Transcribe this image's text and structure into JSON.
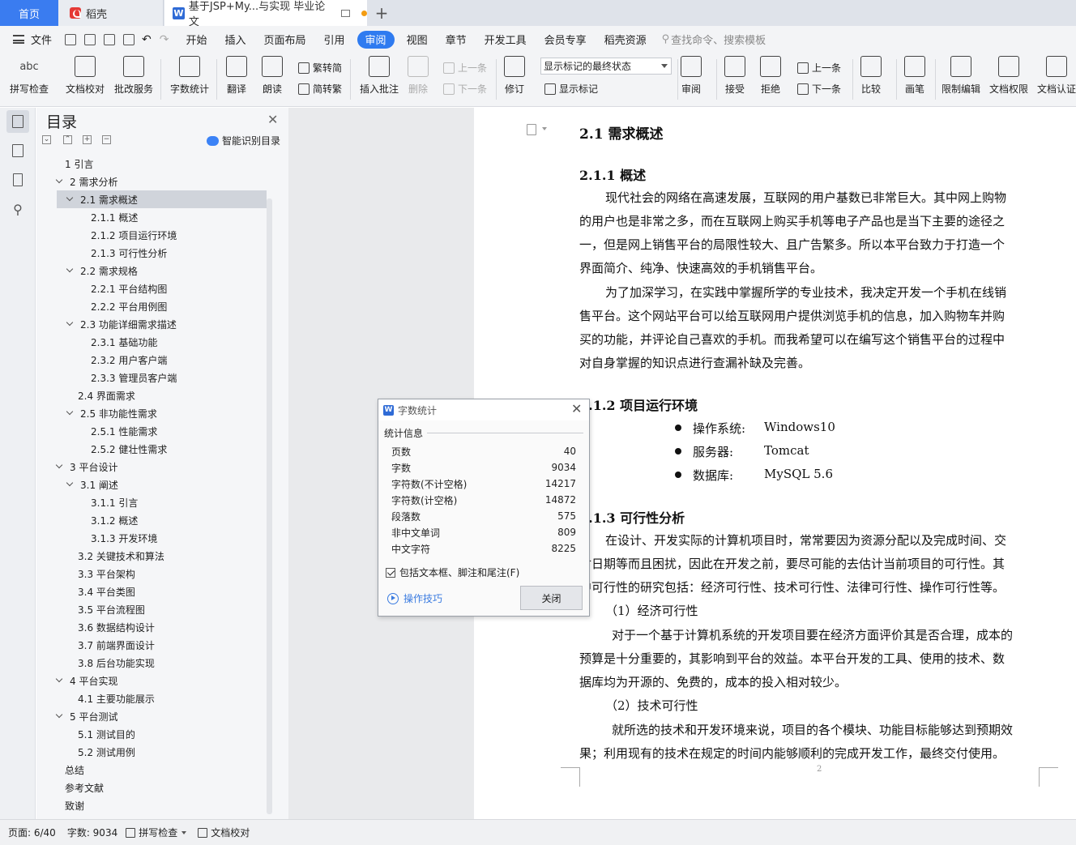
{
  "tabs": {
    "home": "首页",
    "daoke": "稻壳",
    "document": "基于JSP+My...与实现 毕业论文",
    "add": "+"
  },
  "menubar": {
    "file": "文件",
    "items": [
      "开始",
      "插入",
      "页面布局",
      "引用",
      "审阅",
      "视图",
      "章节",
      "开发工具",
      "会员专享",
      "稻壳资源"
    ],
    "active": "审阅",
    "search_placeholder": "查找命令、搜索模板"
  },
  "ribbon": {
    "spellcheck": "拼写检查",
    "doc_proof": "文档校对",
    "batch_service": "批改服务",
    "word_count": "字数统计",
    "translate": "翻译",
    "read_aloud": "朗读",
    "trad_to_simp": "繁转简",
    "simp_to_trad": "简转繁",
    "insert_comment": "插入批注",
    "delete": "删除",
    "prev_comment": "上一条",
    "next_comment": "下一条",
    "track_changes": "修订",
    "show_mode": "显示标记的最终状态",
    "show_markup": "显示标记",
    "review": "审阅",
    "accept": "接受",
    "reject": "拒绝",
    "prev_change": "上一条",
    "next_change": "下一条",
    "compare": "比较",
    "pen": "画笔",
    "restrict_edit": "限制编辑",
    "doc_permission": "文档权限",
    "doc_cert": "文档认证"
  },
  "toc": {
    "title": "目录",
    "smart_label": "智能识别目录",
    "items": [
      {
        "label": "1  引言",
        "level": 1,
        "arrow": false
      },
      {
        "label": "2  需求分析",
        "level": 1,
        "arrow": true
      },
      {
        "label": "2.1  需求概述",
        "level": 2,
        "arrow": true,
        "selected": true
      },
      {
        "label": "2.1.1  概述",
        "level": 3,
        "arrow": false
      },
      {
        "label": "2.1.2  项目运行环境",
        "level": 3,
        "arrow": false
      },
      {
        "label": "2.1.3  可行性分析",
        "level": 3,
        "arrow": false
      },
      {
        "label": "2.2  需求规格",
        "level": 2,
        "arrow": true
      },
      {
        "label": "2.2.1  平台结构图",
        "level": 3,
        "arrow": false
      },
      {
        "label": "2.2.2  平台用例图",
        "level": 3,
        "arrow": false
      },
      {
        "label": "2.3  功能详细需求描述",
        "level": 2,
        "arrow": true
      },
      {
        "label": "2.3.1  基础功能",
        "level": 3,
        "arrow": false
      },
      {
        "label": "2.3.2  用户客户端",
        "level": 3,
        "arrow": false
      },
      {
        "label": "2.3.3  管理员客户端",
        "level": 3,
        "arrow": false
      },
      {
        "label": "2.4  界面需求",
        "level": 2,
        "arrow": false
      },
      {
        "label": "2.5 非功能性需求",
        "level": 2,
        "arrow": true
      },
      {
        "label": "2.5.1  性能需求",
        "level": 3,
        "arrow": false
      },
      {
        "label": "2.5.2  健壮性需求",
        "level": 3,
        "arrow": false
      },
      {
        "label": "3  平台设计",
        "level": 1,
        "arrow": true
      },
      {
        "label": "3.1  阐述",
        "level": 2,
        "arrow": true
      },
      {
        "label": "3.1.1  引言",
        "level": 3,
        "arrow": false
      },
      {
        "label": "3.1.2  概述",
        "level": 3,
        "arrow": false
      },
      {
        "label": "3.1.3  开发环境",
        "level": 3,
        "arrow": false
      },
      {
        "label": "3.2  关键技术和算法",
        "level": 2,
        "arrow": false
      },
      {
        "label": "3.3  平台架构",
        "level": 2,
        "arrow": false
      },
      {
        "label": "3.4  平台类图",
        "level": 2,
        "arrow": false
      },
      {
        "label": "3.5  平台流程图",
        "level": 2,
        "arrow": false
      },
      {
        "label": "3.6  数据结构设计",
        "level": 2,
        "arrow": false
      },
      {
        "label": "3.7  前端界面设计",
        "level": 2,
        "arrow": false
      },
      {
        "label": "3.8  后台功能实现",
        "level": 2,
        "arrow": false
      },
      {
        "label": "4  平台实现",
        "level": 1,
        "arrow": true
      },
      {
        "label": "4.1  主要功能展示",
        "level": 2,
        "arrow": false
      },
      {
        "label": "5  平台测试",
        "level": 1,
        "arrow": true
      },
      {
        "label": "5.1  测试目的",
        "level": 2,
        "arrow": false
      },
      {
        "label": "5.2  测试用例",
        "level": 2,
        "arrow": false
      },
      {
        "label": "总结",
        "level": 1,
        "arrow": false
      },
      {
        "label": "参考文献",
        "level": 1,
        "arrow": false
      },
      {
        "label": "致谢",
        "level": 1,
        "arrow": false
      }
    ]
  },
  "document": {
    "h_2_1": "2.1  需求概述",
    "h_2_1_1": "2.1.1  概述",
    "p1": [
      "现代社会的网络在高速发展，互联网的用户基数已非常巨大。其中网上购物",
      "的用户也是非常之多，而在互联网上购买手机等电子产品也是当下主要的途径之",
      "一，但是网上销售平台的局限性较大、且广告繁多。所以本平台致力于打造一个",
      "界面简介、纯净、快速高效的手机销售平台。"
    ],
    "p2": [
      "为了加深学习，在实践中掌握所学的专业技术，我决定开发一个手机在线销",
      "售平台。这个网站平台可以给互联网用户提供浏览手机的信息，加入购物车并购",
      "买的功能，并评论自己喜欢的手机。而我希望可以在编写这个销售平台的过程中",
      "对自身掌握的知识点进行查漏补缺及完善。"
    ],
    "h_2_1_2": "2.1.2  项目运行环境",
    "env": [
      {
        "key": "操作系统:",
        "value": "Windows10"
      },
      {
        "key": "服务器:",
        "value": "Tomcat"
      },
      {
        "key": "数据库:",
        "value": "MySQL 5.6"
      }
    ],
    "h_2_1_3": "2.1.3  可行性分析",
    "p3": [
      "在设计、开发实际的计算机项目时，常常要因为资源分配以及完成时间、交",
      "付日期等而且困扰，因此在开发之前，要尽可能的去估计当前项目的可行性。其",
      "中可行性的研究包括：经济可行性、技术可行性、法律可行性、操作可行性等。"
    ],
    "sub1": "（1）经济可行性",
    "p4": [
      "对于一个基于计算机系统的开发项目要在经济方面评价其是否合理，成本的",
      "预算是十分重要的，其影响到平台的效益。本平台开发的工具、使用的技术、数",
      "据库均为开源的、免费的，成本的投入相对较少。"
    ],
    "sub2": "（2）技术可行性",
    "p5": [
      "就所选的技术和开发环境来说，项目的各个模块、功能目标能够达到预期效",
      "果；利用现有的技术在规定的时间内能够顺利的完成开发工作，最终交付使用。"
    ],
    "page_number": "2"
  },
  "word_count_dialog": {
    "title": "字数统计",
    "section": "统计信息",
    "rows": [
      {
        "label": "页数",
        "value": "40"
      },
      {
        "label": "字数",
        "value": "9034"
      },
      {
        "label": "字符数(不计空格)",
        "value": "14217"
      },
      {
        "label": "字符数(计空格)",
        "value": "14872"
      },
      {
        "label": "段落数",
        "value": "575"
      },
      {
        "label": "非中文单词",
        "value": "809"
      },
      {
        "label": "中文字符",
        "value": "8225"
      }
    ],
    "include_label": "包括文本框、脚注和尾注(F)",
    "include_checked": true,
    "tips": "操作技巧",
    "close": "关闭"
  },
  "statusbar": {
    "page": "页面: 6/40",
    "words": "字数: 9034",
    "spellcheck": "拼写检查",
    "proof": "文档校对"
  },
  "colors": {
    "accent": "#2f7bf0",
    "home_tab": "#3a7cf0",
    "toc_selected": "#d0d4db"
  }
}
